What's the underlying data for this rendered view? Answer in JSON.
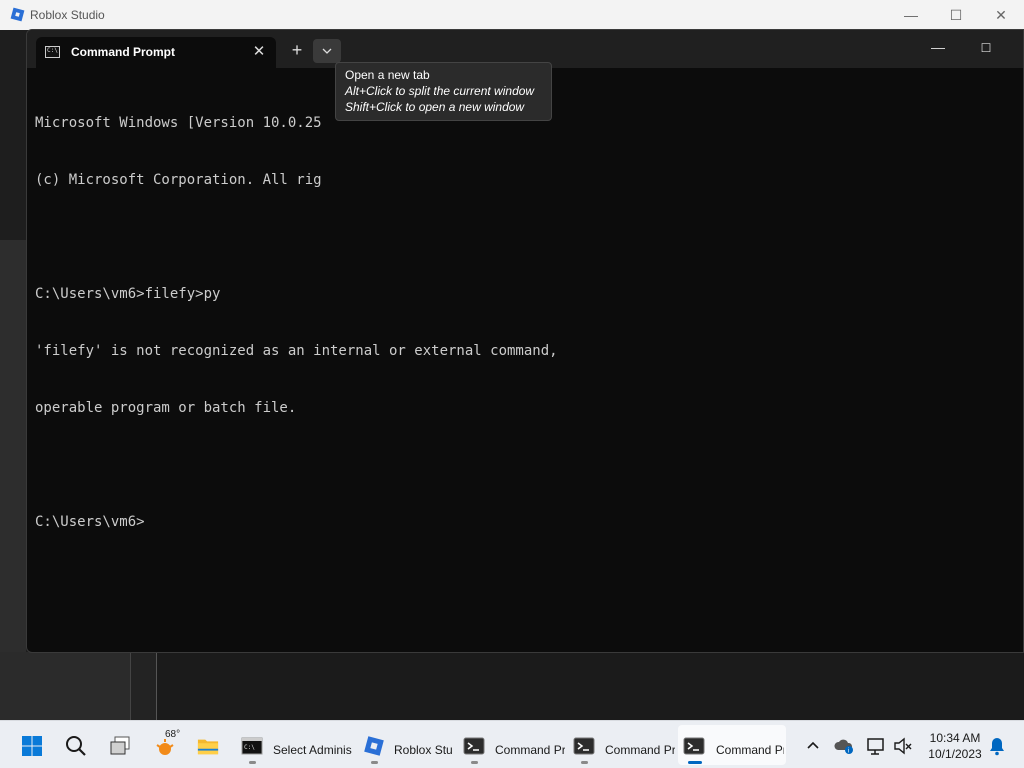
{
  "background_window": {
    "title": "Roblox Studio"
  },
  "terminal": {
    "tab_title": "Command Prompt",
    "new_tab_symbol": "+",
    "dropdown_symbol": "⌵",
    "close_symbol": "✕",
    "console_lines": [
      "Microsoft Windows [Version 10.0.25",
      "(c) Microsoft Corporation. All rig",
      "",
      "C:\\Users\\vm6>filefy>py",
      "'filefy' is not recognized as an internal or external command,",
      "operable program or batch file.",
      "",
      "C:\\Users\\vm6>"
    ]
  },
  "tooltip": {
    "line1": "Open a new tab",
    "line2": "Alt+Click to split the current window",
    "line3": "Shift+Click to open a new window"
  },
  "taskbar": {
    "weather_temp": "68°",
    "apps": [
      {
        "label": "Select Adminis",
        "icon": "cmd-icon"
      },
      {
        "label": "Roblox Stu",
        "icon": "roblox-studio-icon"
      },
      {
        "label": "Command Pr",
        "icon": "terminal-icon"
      },
      {
        "label": "Command Pr",
        "icon": "terminal-icon"
      },
      {
        "label": "Command Pr",
        "icon": "terminal-icon",
        "active": true
      }
    ],
    "time": "10:34 AM",
    "date": "10/1/2023"
  },
  "colors": {
    "accent": "#0067c0",
    "terminal_bg": "#0c0c0c",
    "terminal_text": "#cccccc"
  }
}
